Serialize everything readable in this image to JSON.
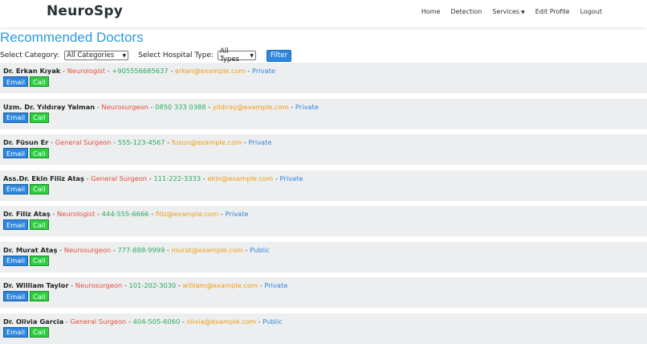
{
  "nav": {
    "brand": "NeuroSpy",
    "links": [
      "Home",
      "Detection",
      "Services",
      "Edit Profile",
      "Logout"
    ]
  },
  "page": {
    "title": "Recommended Doctors"
  },
  "filters": {
    "category_label": "Select Category:",
    "category_value": "All Categories",
    "hospital_label": "Select Hospital Type:",
    "hospital_value": "All Types",
    "button": "Filter"
  },
  "buttons": {
    "email": "Email",
    "call": "Call"
  },
  "doctors": [
    {
      "name": "Dr. Erkan Kıyak",
      "specialty": "Neurologist",
      "phone": "+905556685637",
      "email": "erkan@example.com",
      "type": "Private"
    },
    {
      "name": "Uzm. Dr. Yıldıray Yalman",
      "specialty": "Neurosurgeon",
      "phone": "0850 333 0388",
      "email": "yildiray@example.com",
      "type": "Private"
    },
    {
      "name": "Dr. Füsun Er",
      "specialty": "General Surgeon",
      "phone": "555-123-4567",
      "email": "fusun@example.com",
      "type": "Private"
    },
    {
      "name": "Ass.Dr. Ekin Filiz Ataş",
      "specialty": "General Surgeon",
      "phone": "111-222-3333",
      "email": "ekin@example.com",
      "type": "Private"
    },
    {
      "name": "Dr. Filiz Ataş",
      "specialty": "Neurologist",
      "phone": "444-555-6666",
      "email": "filiz@example.com",
      "type": "Private"
    },
    {
      "name": "Dr. Murat Ataş",
      "specialty": "Neurosurgeon",
      "phone": "777-888-9999",
      "email": "murat@example.com",
      "type": "Public"
    },
    {
      "name": "Dr. William Taylor",
      "specialty": "Neurosurgeon",
      "phone": "101-202-3030",
      "email": "william@example.com",
      "type": "Private"
    },
    {
      "name": "Dr. Olivia Garcia",
      "specialty": "General Surgeon",
      "phone": "404-505-6060",
      "email": "olivia@example.com",
      "type": "Public"
    }
  ]
}
